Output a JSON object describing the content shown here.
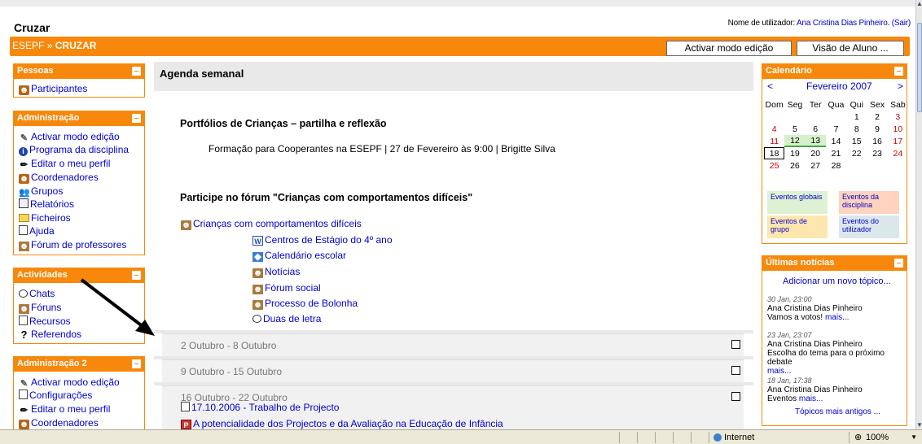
{
  "site": {
    "title": "Cruzar"
  },
  "user": {
    "prefix": "Nome de utilizador: ",
    "name": "Ana Cristina Dias Pinheiro",
    "logout": "(Sair)"
  },
  "nav": {
    "home": "ESEPF",
    "sep": "»",
    "current": "CRUZAR",
    "btn_edit": "Activar modo edição",
    "btn_student": "Visão de Aluno ..."
  },
  "blocks": {
    "pessoas": {
      "title": "Pessoas",
      "items": [
        "Participantes"
      ]
    },
    "admin": {
      "title": "Administração",
      "items": [
        "Activar modo edição",
        "Programa da disciplina",
        "Editar o meu perfil",
        "Coordenadores",
        "Grupos",
        "Relatórios",
        "Ficheiros",
        "Ajuda",
        "Fórum de professores"
      ]
    },
    "actividades": {
      "title": "Actividades",
      "items": [
        "Chats",
        "Fóruns",
        "Recursos",
        "Referendos"
      ]
    },
    "admin2": {
      "title": "Administração 2",
      "items": [
        "Activar modo edição",
        "Configurações",
        "Editar o meu perfil",
        "Coordenadores"
      ]
    }
  },
  "main": {
    "title": "Agenda semanal",
    "heading1": "Portfólios de Crianças – partilha e reflexão",
    "text1": "Formação para Cooperantes na ESEPF | 27 de Fevereiro às 9:00 | Brigitte Silva",
    "heading2": "Participe no fórum \"Crianças com comportamentos difíceis\"",
    "forum_link": "Crianças com comportamentos difíceis",
    "sublinks": [
      "Centros de Estágio do 4º ano",
      "Calendário escolar",
      "Notícias",
      "Fórum social",
      "Processo de Bolonha",
      "Duas de letra"
    ],
    "weeks": [
      "2 Outubro - 8 Outubro",
      "9 Outubro - 15 Outubro",
      "16 Outubro - 22 Outubro"
    ],
    "week3_items": [
      "17.10.2006 - Trabalho de Projecto",
      "A potencialidade dos Projectos e da Avaliação na Educação de Infância"
    ]
  },
  "calendar": {
    "title": "Calendário",
    "prev": "<",
    "next": ">",
    "month": "Fevereiro 2007",
    "days": [
      "Dom",
      "Seg",
      "Ter",
      "Qua",
      "Qui",
      "Sex",
      "Sab"
    ],
    "weeks": [
      [
        "",
        "",
        "",
        "",
        "1",
        "2",
        "3"
      ],
      [
        "4",
        "5",
        "6",
        "7",
        "8",
        "9",
        "10"
      ],
      [
        "11",
        "12",
        "13",
        "14",
        "15",
        "16",
        "17"
      ],
      [
        "18",
        "19",
        "20",
        "21",
        "22",
        "23",
        "24"
      ],
      [
        "25",
        "26",
        "27",
        "28",
        "",
        "",
        ""
      ]
    ],
    "legend": [
      "Eventos globais",
      "Eventos da disciplina",
      "Eventos de grupo",
      "Eventos do utilizador"
    ],
    "legend_colors": [
      "#dff1d3",
      "#ffd3bd",
      "#fee7ae",
      "#dce7ec"
    ]
  },
  "news": {
    "title": "Últimas notícias",
    "add": "Adicionar um novo tópico...",
    "items": [
      {
        "date": "30 Jan, 23:00",
        "author": "Ana Cristina Dias Pinheiro",
        "text": "Vamos a votos!",
        "more": "mais..."
      },
      {
        "date": "23 Jan, 23:07",
        "author": "Ana Cristina Dias Pinheiro",
        "text": "Escolha do tema para o próximo debate",
        "more": "mais..."
      },
      {
        "date": "18 Jan, 17:38",
        "author": "Ana Cristina Dias Pinheiro",
        "text": "Eventos",
        "more": "mais..."
      }
    ],
    "older": "Tópicos mais antigos ..."
  },
  "status": {
    "zone": "Internet",
    "zoom": "100%"
  }
}
